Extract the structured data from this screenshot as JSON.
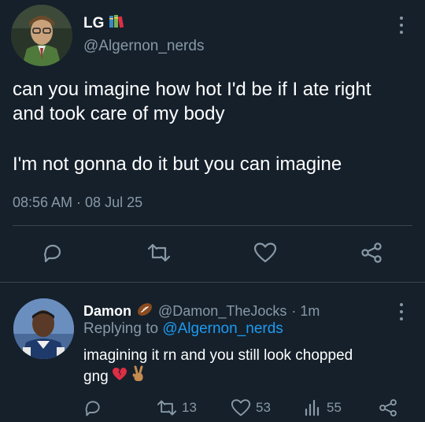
{
  "main_tweet": {
    "display_name": "LG",
    "badge_emoji": "books-emoji",
    "handle": "@Algernon_nerds",
    "text_line1": "can you imagine how hot I'd be if I ate right",
    "text_line2": "and took care of my body",
    "text_line3": "I'm not gonna do it but you can imagine",
    "timestamp": "08:56 AM · 08 Jul 25"
  },
  "reply": {
    "display_name": "Damon",
    "badge_emoji": "football-emoji",
    "handle": "@Damon_TheJocks",
    "time": "· 1m",
    "replying_prefix": "Replying to",
    "replying_to": "@Algernon_nerds",
    "text_line1": "imagining it rn and you still look chopped",
    "text_line2": "gng",
    "trailing_emojis": [
      "broken-heart-emoji",
      "victory-hand-emoji"
    ],
    "stats": {
      "retweets": "13",
      "likes": "53",
      "views": "55"
    }
  },
  "colors": {
    "background": "#15202b",
    "secondary_text": "#8899a6",
    "link": "#1d9bf0",
    "divider": "#38444d"
  }
}
